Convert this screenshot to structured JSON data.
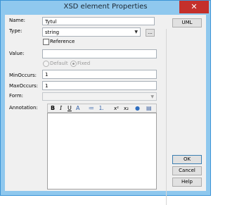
{
  "window": {
    "title": "XSD element Properties",
    "close_glyph": "✕"
  },
  "fields": {
    "name": {
      "label": "Name:",
      "value": "Tytul"
    },
    "type": {
      "label": "Type:",
      "value": "string",
      "browse_label": "..."
    },
    "reference": {
      "label": "Reference",
      "checked": false
    },
    "value": {
      "label": "Value:",
      "value": ""
    },
    "value_mode": {
      "options": [
        "Default",
        "Fixed"
      ],
      "selected": "Fixed"
    },
    "min_occurs": {
      "label": "MinOccurs:",
      "value": "1"
    },
    "max_occurs": {
      "label": "MaxOccurs:",
      "value": "1"
    },
    "form": {
      "label": "Form:",
      "value": ""
    },
    "annotation": {
      "label": "Annotation:",
      "text": ""
    }
  },
  "toolbar": {
    "bold": "B",
    "italic": "I",
    "underline": "U",
    "font_color": "A",
    "bullets": "≔",
    "numbering": "⒈",
    "superscript": "x²",
    "subscript": "x₂",
    "link": "●",
    "insert": "▤"
  },
  "buttons": {
    "uml": "UML",
    "ok": "OK",
    "cancel": "Cancel",
    "help": "Help"
  }
}
